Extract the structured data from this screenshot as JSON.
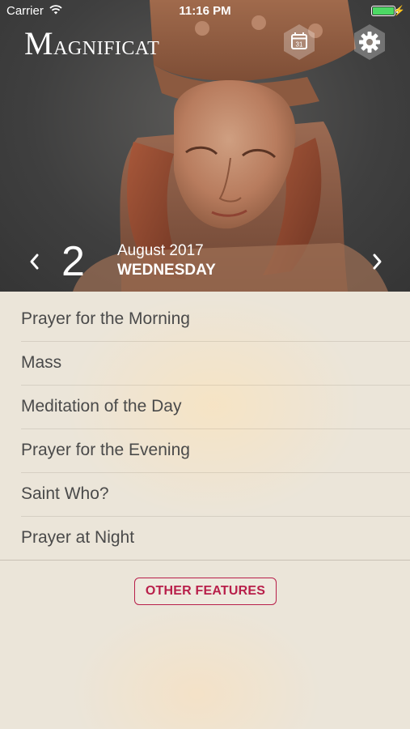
{
  "status_bar": {
    "carrier": "Carrier",
    "time": "11:16 PM",
    "battery_color": "#4cd964"
  },
  "header": {
    "logo_initial": "M",
    "logo_rest": "AGNIFICAT",
    "calendar_day": "31",
    "calendar_icon": "calendar-icon",
    "settings_icon": "gear-icon"
  },
  "date": {
    "day": "2",
    "month_year": "August 2017",
    "weekday": "WEDNESDAY"
  },
  "menu": {
    "items": [
      {
        "label": "Prayer for the Morning"
      },
      {
        "label": "Mass"
      },
      {
        "label": "Meditation of the Day"
      },
      {
        "label": "Prayer for the Evening"
      },
      {
        "label": "Saint Who?"
      },
      {
        "label": "Prayer at Night"
      }
    ],
    "other_features": "OTHER FEATURES"
  },
  "colors": {
    "accent": "#b81f4a",
    "menu_text": "#4a4a4a",
    "background": "#ebe5d9"
  }
}
